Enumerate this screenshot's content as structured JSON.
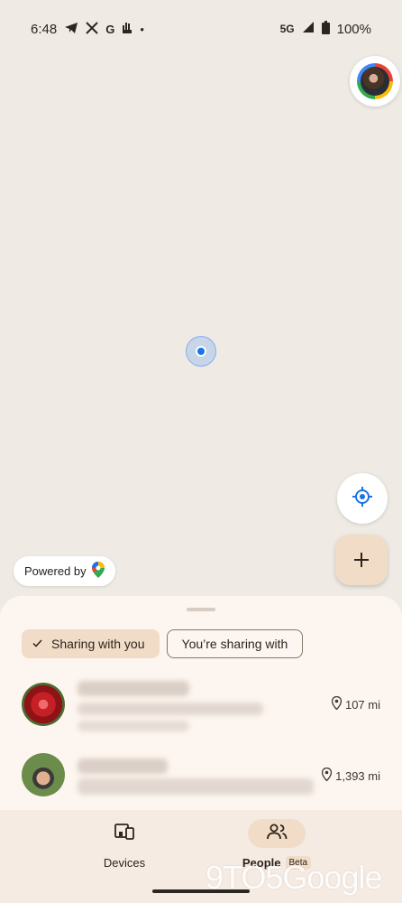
{
  "status_bar": {
    "time": "6:48",
    "notification_icons": [
      "telegram-icon",
      "x-icon",
      "google-icon",
      "hand-icon"
    ],
    "network": "5G",
    "battery": "100%"
  },
  "map": {
    "powered_by": "Powered by"
  },
  "sheet": {
    "chips": {
      "sharing_with_you": "Sharing with you",
      "you_are_sharing_with": "You’re sharing with"
    },
    "people": [
      {
        "distance": "107 mi"
      },
      {
        "distance": "1,393 mi"
      }
    ]
  },
  "nav": {
    "devices": "Devices",
    "people": "People",
    "beta": "Beta"
  },
  "watermark": "9TO5Google",
  "colors": {
    "map_background": "#efebe4",
    "sheet_background": "#fdf5ef",
    "accent_chip": "#f1dcc7",
    "location_blue": "#1a73e8"
  }
}
